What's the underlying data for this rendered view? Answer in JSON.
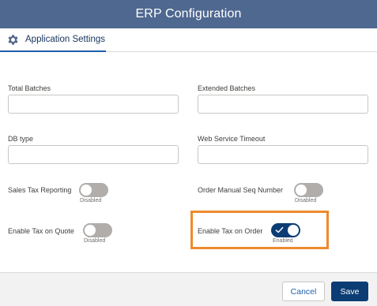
{
  "header": {
    "title": "ERP Configuration"
  },
  "tabs": [
    {
      "label": "Application Settings",
      "icon": "gear-icon"
    }
  ],
  "fields": {
    "total_batches": {
      "label": "Total Batches",
      "value": ""
    },
    "extended_batches": {
      "label": "Extended Batches",
      "value": ""
    },
    "db_type": {
      "label": "DB type",
      "value": ""
    },
    "web_service_timeout": {
      "label": "Web Service Timeout",
      "value": ""
    }
  },
  "toggles": {
    "sales_tax_reporting": {
      "label": "Sales Tax Reporting",
      "state": "Disabled",
      "on": false
    },
    "order_manual_seq_number": {
      "label": "Order Manual Seq Number",
      "state": "Disabled",
      "on": false
    },
    "enable_tax_on_quote": {
      "label": "Enable Tax on Quote",
      "state": "Disabled",
      "on": false
    },
    "enable_tax_on_order": {
      "label": "Enable Tax on Order",
      "state": "Enabled",
      "on": true
    }
  },
  "footer": {
    "cancel_label": "Cancel",
    "save_label": "Save"
  },
  "colors": {
    "header_bg": "#4f6890",
    "brand": "#0b3d74",
    "toggle_off": "#b0adab",
    "highlight": "#ee8a2c"
  }
}
